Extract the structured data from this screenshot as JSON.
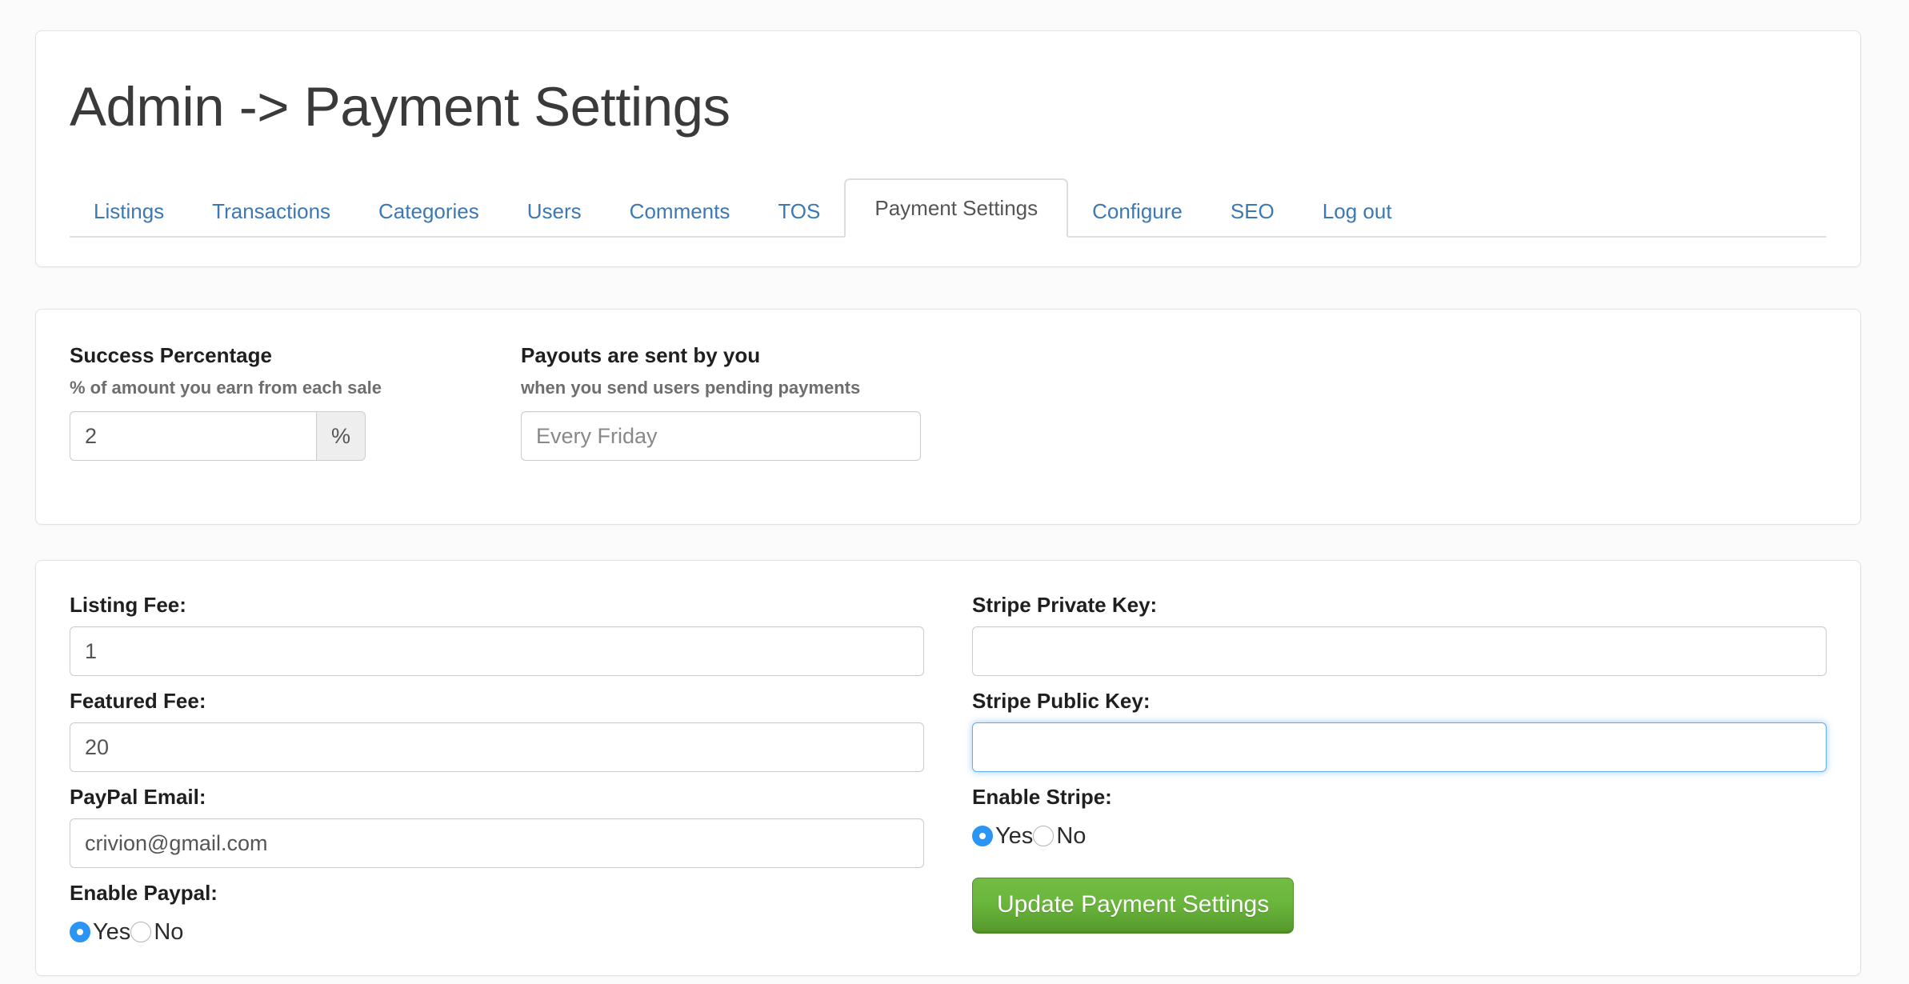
{
  "page": {
    "title": "Admin -> Payment Settings",
    "background_color": "#fbfbfb",
    "link_color": "#3c78b4",
    "accent_green": "#6ab63c",
    "focus_blue": "#66afe9",
    "radio_blue": "#2b95f5"
  },
  "tabs": [
    {
      "label": "Listings",
      "active": false
    },
    {
      "label": "Transactions",
      "active": false
    },
    {
      "label": "Categories",
      "active": false
    },
    {
      "label": "Users",
      "active": false
    },
    {
      "label": "Comments",
      "active": false
    },
    {
      "label": "TOS",
      "active": false
    },
    {
      "label": "Payment Settings",
      "active": true
    },
    {
      "label": "Configure",
      "active": false
    },
    {
      "label": "SEO",
      "active": false
    },
    {
      "label": "Log out",
      "active": false
    }
  ],
  "rates_panel": {
    "success_percentage": {
      "label": "Success Percentage",
      "sublabel": "% of amount you earn from each sale",
      "value": "2",
      "addon": "%"
    },
    "payouts": {
      "label": "Payouts are sent by you",
      "sublabel": "when you send users pending payments",
      "value": "",
      "placeholder": "Every Friday"
    }
  },
  "fees_panel": {
    "listing_fee": {
      "label": "Listing Fee:",
      "value": "1"
    },
    "featured_fee": {
      "label": "Featured Fee:",
      "value": "20"
    },
    "paypal_email": {
      "label": "PayPal Email:",
      "value": "crivion@gmail.com"
    },
    "enable_paypal": {
      "label": "Enable Paypal:",
      "yes_label": "Yes",
      "no_label": "No",
      "selected": "Yes"
    },
    "stripe_private_key": {
      "label": "Stripe Private Key:",
      "value": ""
    },
    "stripe_public_key": {
      "label": "Stripe Public Key:",
      "value": "",
      "focused": true
    },
    "enable_stripe": {
      "label": "Enable Stripe:",
      "yes_label": "Yes",
      "no_label": "No",
      "selected": "Yes"
    },
    "submit_button": {
      "label": "Update Payment Settings"
    }
  }
}
